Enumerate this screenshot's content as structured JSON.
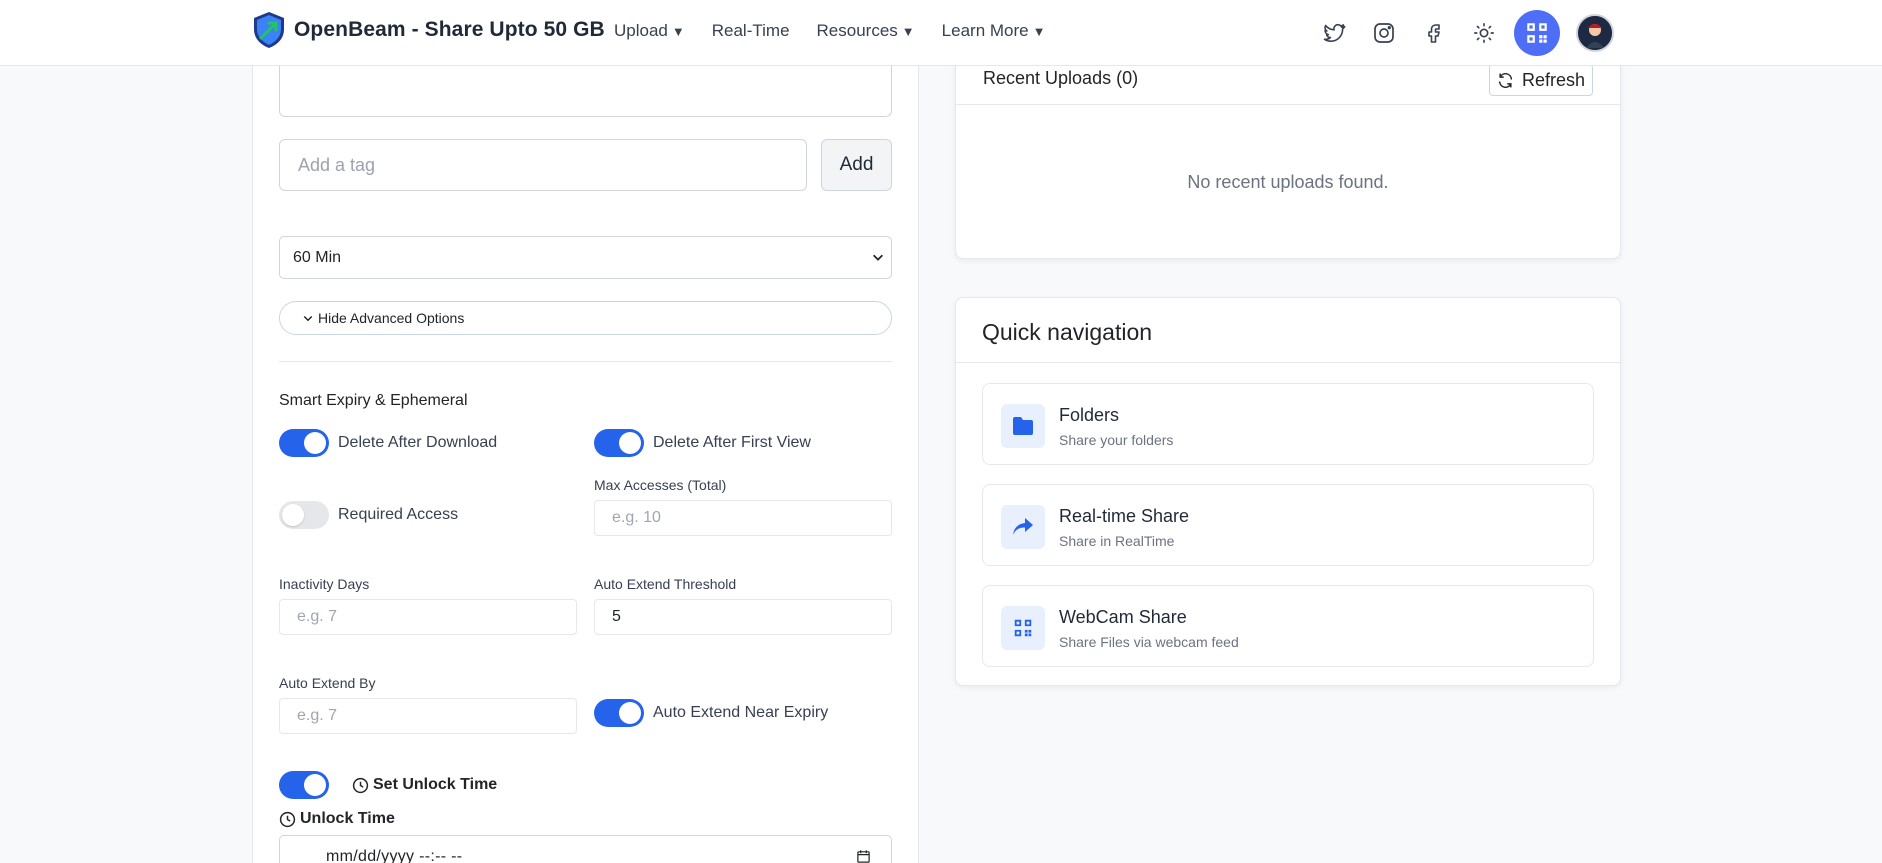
{
  "header": {
    "brand": "OpenBeam - Share Upto 50 GB",
    "nav": [
      {
        "label": "Upload",
        "caret": "▼"
      },
      {
        "label": "Real-Time",
        "caret": ""
      },
      {
        "label": "Resources",
        "caret": "▼"
      },
      {
        "label": "Learn More",
        "caret": "▼"
      }
    ],
    "icons": [
      "twitter-icon",
      "instagram-icon",
      "facebook-icon",
      "sun-icon",
      "qr-code-icon",
      "avatar"
    ]
  },
  "form": {
    "tag_placeholder": "Add a tag",
    "add_label": "Add",
    "expiry_value": "60 Min",
    "advanced_toggle_label": "Hide Advanced Options",
    "section_title": "Smart Expiry & Ephemeral",
    "delete_after_download": {
      "label": "Delete After Download",
      "on": true
    },
    "delete_after_first_view": {
      "label": "Delete After First View",
      "on": true
    },
    "required_access": {
      "label": "Required Access",
      "on": false
    },
    "max_accesses": {
      "label": "Max Accesses (Total)",
      "placeholder": "e.g. 10"
    },
    "inactivity_days": {
      "label": "Inactivity Days",
      "placeholder": "e.g. 7"
    },
    "auto_extend_threshold": {
      "label": "Auto Extend Threshold",
      "value": "5"
    },
    "auto_extend_by": {
      "label": "Auto Extend By",
      "placeholder": "e.g. 7"
    },
    "auto_extend_near_expiry": {
      "label": "Auto Extend Near Expiry",
      "on": true
    },
    "set_unlock_time": {
      "label": "Set Unlock Time",
      "on": true
    },
    "unlock_time_label": "Unlock Time",
    "unlock_time_placeholder": "mm/dd/yyyy --:-- --"
  },
  "recent": {
    "title": "Recent Uploads (0)",
    "refresh_label": "Refresh",
    "empty_message": "No recent uploads found."
  },
  "quick_nav": {
    "title": "Quick navigation",
    "items": [
      {
        "name": "Folders",
        "desc": "Share your folders",
        "icon": "folder-icon"
      },
      {
        "name": "Real-time Share",
        "desc": "Share in RealTime",
        "icon": "share-arrow-icon"
      },
      {
        "name": "WebCam Share",
        "desc": "Share Files via webcam feed",
        "icon": "qr-code-icon"
      }
    ]
  },
  "colors": {
    "accent": "#2563eb",
    "qr_button": "#4f6ef7",
    "icon_bg": "#e8effd"
  }
}
